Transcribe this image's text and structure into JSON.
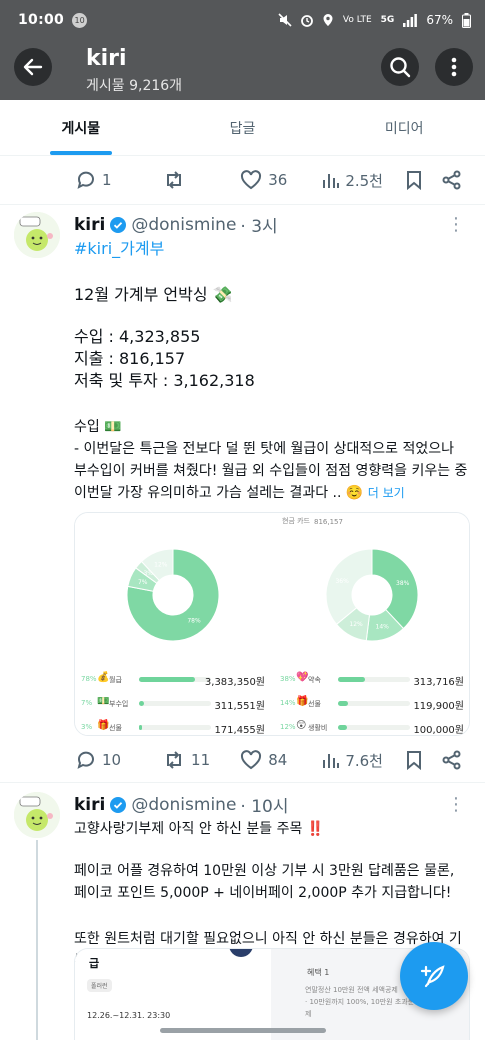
{
  "status_bar": {
    "time": "10:00",
    "badge": "10",
    "network": "5G",
    "carrier": "Vo LTE",
    "battery": "67%"
  },
  "header": {
    "title": "kiri",
    "subtitle": "게시물 9,216개"
  },
  "tabs": [
    {
      "label": "게시물"
    },
    {
      "label": "답글"
    },
    {
      "label": "미디어"
    }
  ],
  "top_actions": {
    "replies": "1",
    "reposts": "",
    "likes": "36",
    "views": "2.5천"
  },
  "post1": {
    "name": "kiri",
    "handle": "@donismine",
    "time": "· 3시",
    "hashtag": "#kiri_가계부",
    "line1": "12월 가계부 언박싱 💸",
    "income": "수입 : 4,323,855",
    "expense": "지출 : 816,157",
    "savings": "저축 및 투자 : 3,162,318",
    "income_head": "수입 💵",
    "body": "- 이번달은 특근을 전보다 덜 뛴 탓에 월급이 상대적으로 적었으나 부수입이 커버를 쳐줬다! 월급 외 수입들이 점점 영향력을 키우는 중 이번달 가장 유의미하고 가슴 설레는 결과다 .. ☺️",
    "more": "더 보기",
    "actions": {
      "replies": "10",
      "reposts": "11",
      "likes": "84",
      "views": "7.6천"
    },
    "chart_left": {
      "type": "pie",
      "slices": [
        {
          "label": "월급",
          "value": 78
        },
        {
          "label": "부수입",
          "value": 7
        },
        {
          "label": "선물",
          "value": 3
        },
        {
          "label": "기타",
          "value": 12
        }
      ],
      "center_label": "78%",
      "rows": [
        {
          "pct": "78%",
          "emoji": "💰",
          "label": "월급",
          "fill": 0.78,
          "amount": "3,383,350원"
        },
        {
          "pct": "7%",
          "emoji": "💵",
          "label": "부수입",
          "fill": 0.07,
          "amount": "311,551원"
        },
        {
          "pct": "3%",
          "emoji": "🎁",
          "label": "선물",
          "fill": 0.03,
          "amount": "171,455원"
        }
      ]
    },
    "chart_right": {
      "type": "pie",
      "header_label": "현금 카드",
      "header_value": "816,157",
      "slices": [
        {
          "label": "약속",
          "value": 38
        },
        {
          "label": "선물",
          "value": 14
        },
        {
          "label": "생활비",
          "value": 12
        },
        {
          "label": "기타",
          "value": 36
        }
      ],
      "rows": [
        {
          "pct": "38%",
          "emoji": "💖",
          "label": "약속",
          "fill": 0.38,
          "amount": "313,716원"
        },
        {
          "pct": "14%",
          "emoji": "🎁",
          "label": "선물",
          "fill": 0.14,
          "amount": "119,900원"
        },
        {
          "pct": "12%",
          "emoji": "😲",
          "label": "생활비",
          "fill": 0.12,
          "amount": "100,000원"
        }
      ]
    }
  },
  "post2": {
    "name": "kiri",
    "handle": "@donismine",
    "time": "· 10시",
    "line1": "고향사랑기부제 아직 안 하신 분들 주목 ‼️",
    "line2": "페이코 어플 경유하여 10만원 이상 기부 시 3만원 답례품은 물론, 페이코 포인트 5,000P + 네이버페이 2,000P 추가 지급합니다!",
    "line3": "또한 원트처럼 대기할 필요없으니 아직 안 하신 분들은 경유하여 기부하셔요 🥰",
    "media_left_title": "급",
    "media_left_tag": "폴러런",
    "media_left_date": "12.26.~12.31. 23:30",
    "media_right_title": "혜택 1",
    "media_right_l1": "연말정산 10만원 전액 세액공제",
    "media_right_l2": "· 10만원까지 100%, 10만원 초과분 16.5",
    "media_right_l3": "제"
  }
}
